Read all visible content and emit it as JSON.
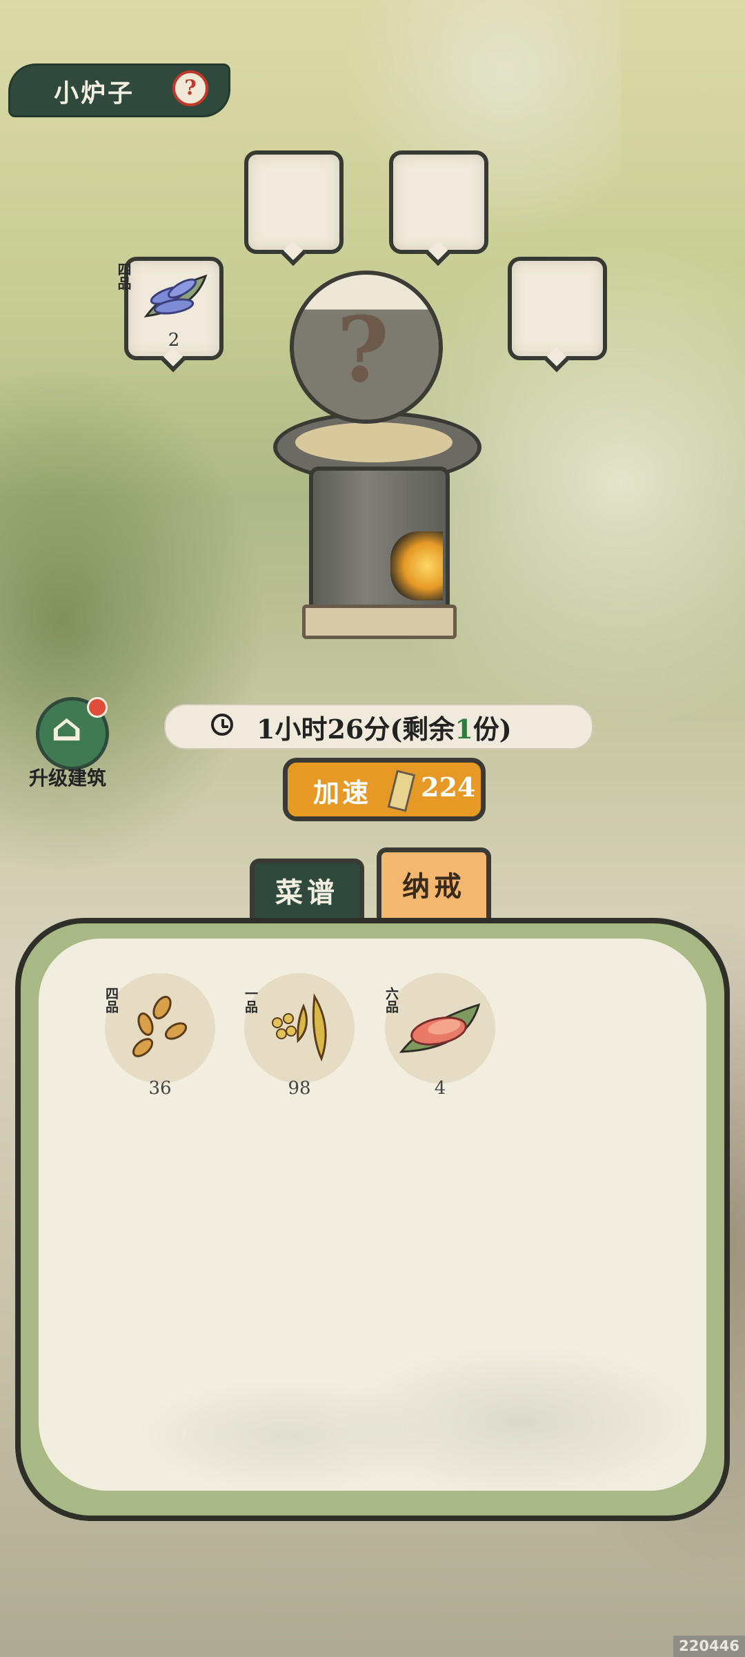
{
  "header": {
    "title": "小炉子",
    "help_glyph": "?"
  },
  "slots": [
    {
      "grade": "四品",
      "count": "2",
      "icon": "lavender-herb-icon",
      "filled": true
    },
    {
      "grade": "",
      "count": "",
      "icon": "",
      "filled": false
    },
    {
      "grade": "",
      "count": "",
      "icon": "",
      "filled": false
    },
    {
      "grade": "",
      "count": "",
      "icon": "",
      "filled": false
    }
  ],
  "pot": {
    "unknown_glyph": "?"
  },
  "upgrade": {
    "label": "升级建筑",
    "icon": "upgrade-building-icon"
  },
  "timer": {
    "prefix": "1小时26分(剩余",
    "remaining": "1",
    "suffix": "份)"
  },
  "speed_up": {
    "label": "加速",
    "cost": "224",
    "icon": "ticket-icon"
  },
  "tabs": [
    {
      "label": "菜谱",
      "active": false
    },
    {
      "label": "纳戒",
      "active": true
    }
  ],
  "inventory": [
    {
      "grade": "四品",
      "count": "36",
      "icon": "seeds-icon"
    },
    {
      "grade": "一品",
      "count": "98",
      "icon": "soybean-icon"
    },
    {
      "grade": "六品",
      "count": "4",
      "icon": "sweet-potato-icon"
    }
  ],
  "watermark": "220446",
  "colors": {
    "banner": "#2f4a3c",
    "accent": "#e69a25",
    "panel_border": "#a9b985",
    "panel_bg": "#f2eedf"
  }
}
